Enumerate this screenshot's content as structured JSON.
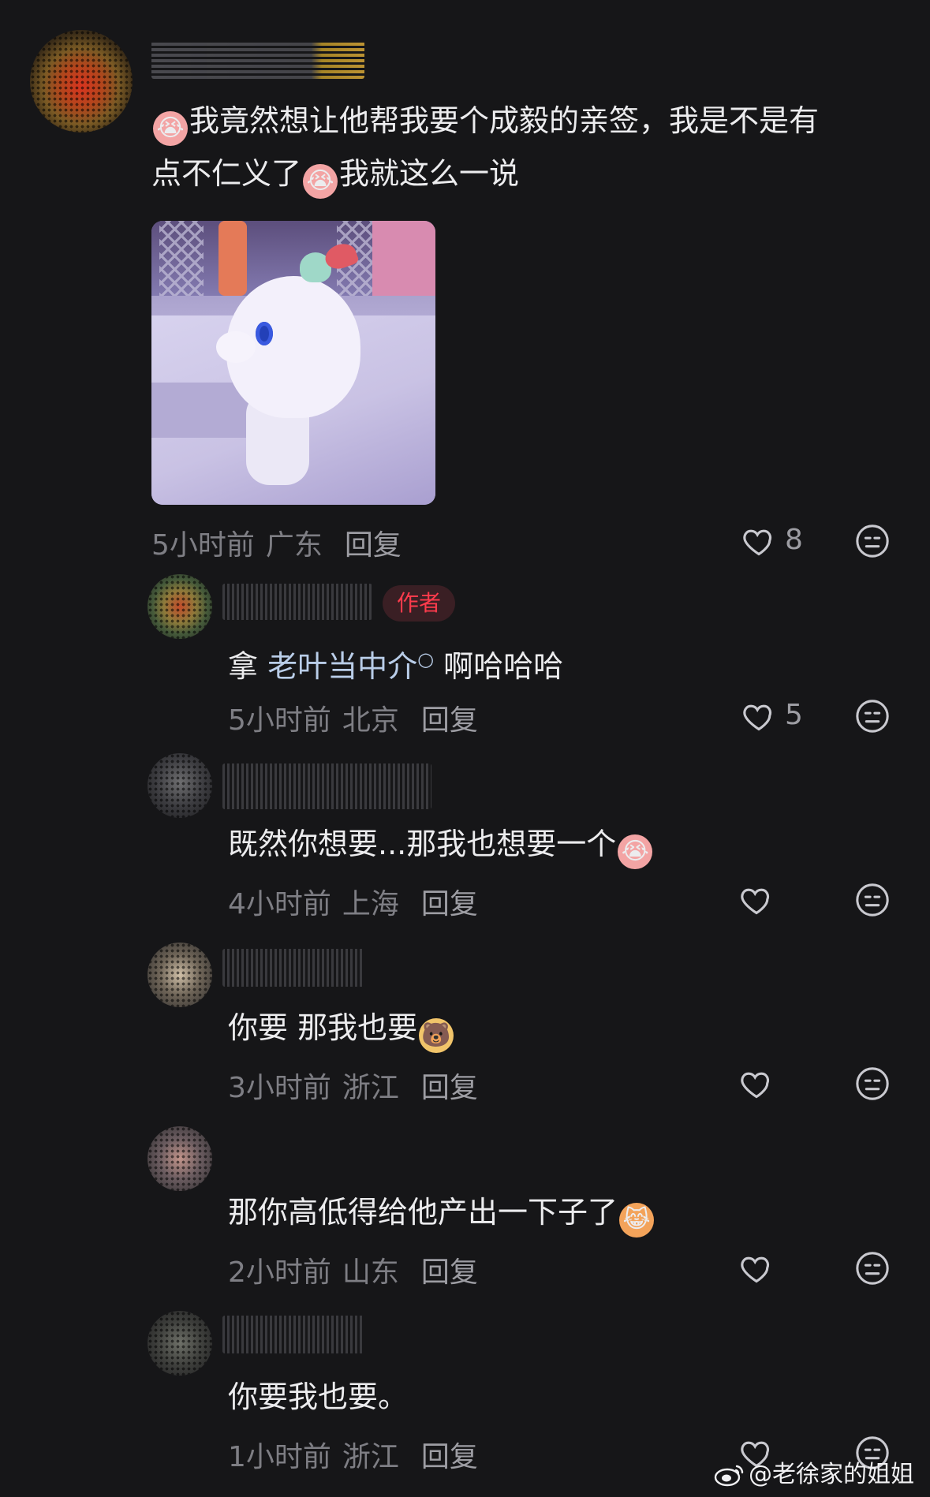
{
  "comments": [
    {
      "text_parts": [
        "我竟然想让他帮我要个成毅的亲签，我是不是有",
        "点不仁义了",
        "我就这么一说"
      ],
      "time": "5小时前",
      "location": "广东",
      "reply_label": "回复",
      "likes": "8"
    },
    {
      "author_badge": "作者",
      "text_prefix": "拿 ",
      "text_link": "老叶当中介",
      "text_suffix": " 啊哈哈哈",
      "time": "5小时前",
      "location": "北京",
      "reply_label": "回复",
      "likes": "5"
    },
    {
      "text": "既然你想要...那我也想要一个",
      "time": "4小时前",
      "location": "上海",
      "reply_label": "回复"
    },
    {
      "text": "你要 那我也要",
      "time": "3小时前",
      "location": "浙江",
      "reply_label": "回复"
    },
    {
      "text": "那你高低得给他产出一下子了",
      "time": "2小时前",
      "location": "山东",
      "reply_label": "回复"
    },
    {
      "text": "你要我也要。",
      "time": "1小时前",
      "location": "浙江",
      "reply_label": "回复"
    }
  ],
  "watermark": "@老徐家的姐姐",
  "colors": {
    "background": "#161618",
    "author_badge": "#ff3b4c",
    "link": "#b9cde8"
  }
}
